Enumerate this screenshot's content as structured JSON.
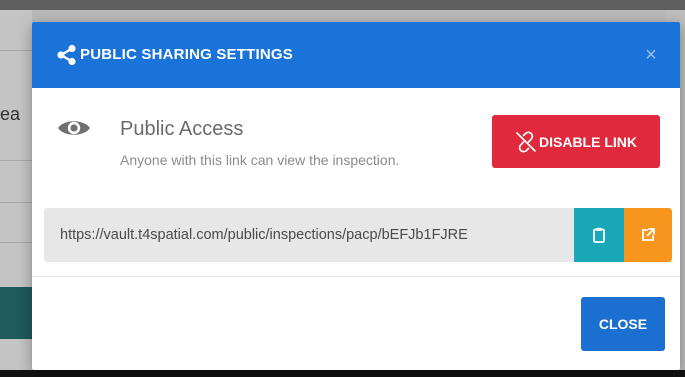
{
  "background": {
    "partial_text": "ea"
  },
  "modal": {
    "title": "PUBLIC SHARING SETTINGS",
    "title_icon": "share-icon",
    "close_symbol": "×",
    "access": {
      "icon": "eye-icon",
      "title": "Public Access",
      "description": "Anyone with this link can view the inspection."
    },
    "disable_button": {
      "label": "DISABLE LINK",
      "icon": "broken-link-icon"
    },
    "link": {
      "value": "https://vault.t4spatial.com/public/inspections/pacp/bEFJb1FJRE",
      "copy_icon": "clipboard-icon",
      "open_icon": "external-link-icon"
    },
    "footer": {
      "close_label": "CLOSE"
    }
  },
  "colors": {
    "header": "#1a73d9",
    "danger": "#e0293c",
    "info": "#1aa7b8",
    "warning": "#f7951d",
    "primary": "#1a6fd0"
  }
}
